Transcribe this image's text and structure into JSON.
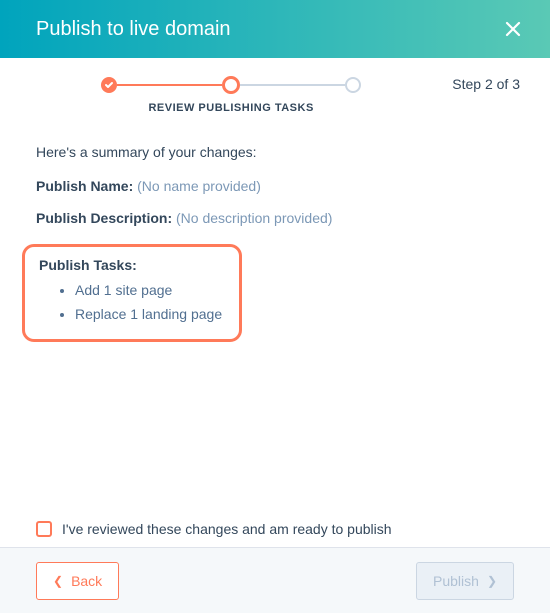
{
  "header": {
    "title": "Publish to live domain"
  },
  "stepper": {
    "current_label": "REVIEW PUBLISHING TASKS",
    "step_indicator": "Step 2 of 3"
  },
  "summary": {
    "intro": "Here's a summary of your changes:",
    "name_label": "Publish Name:",
    "name_value": "(No name provided)",
    "description_label": "Publish Description:",
    "description_value": "(No description provided)",
    "tasks_label": "Publish Tasks:",
    "tasks": [
      "Add 1 site page",
      "Replace 1 landing page"
    ]
  },
  "review": {
    "label": "I've reviewed these changes and am ready to publish",
    "checked": false
  },
  "footer": {
    "back_label": "Back",
    "publish_label": "Publish"
  }
}
